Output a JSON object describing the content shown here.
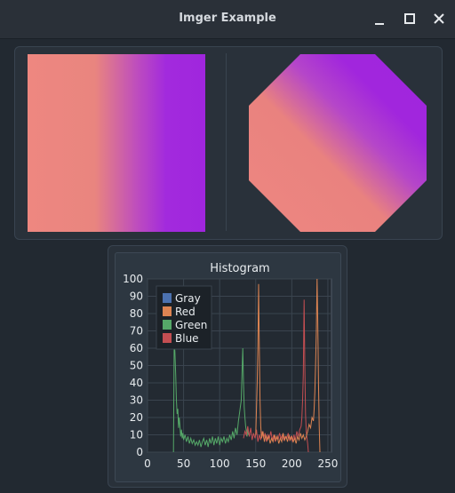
{
  "window": {
    "title": "Imger Example",
    "controls": [
      "minimize-icon",
      "maximize-icon",
      "close-icon"
    ]
  },
  "images": {
    "left_label": "gradient-square",
    "right_label": "gradient-octagon",
    "colors": {
      "pink": "#ee8780",
      "purple": "#a126dd"
    }
  },
  "chart_data": {
    "type": "line",
    "title": "Histogram",
    "xlim": [
      0,
      255
    ],
    "ylim": [
      0,
      100
    ],
    "xticks": [
      0,
      50,
      100,
      150,
      200,
      250
    ],
    "yticks": [
      0,
      10,
      20,
      30,
      40,
      50,
      60,
      70,
      80,
      90,
      100
    ],
    "legend": {
      "placement": "top-left",
      "entries": [
        {
          "name": "Gray",
          "color": "#4c72b0"
        },
        {
          "name": "Red",
          "color": "#dd8452"
        },
        {
          "name": "Green",
          "color": "#55a868"
        },
        {
          "name": "Blue",
          "color": "#c44e52"
        }
      ]
    },
    "series": [
      {
        "name": "Gray",
        "color": "#4c72b0",
        "points": []
      },
      {
        "name": "Green",
        "color": "#55a868",
        "points": [
          [
            36,
            0
          ],
          [
            37,
            64
          ],
          [
            38,
            58
          ],
          [
            39,
            45
          ],
          [
            40,
            30
          ],
          [
            41,
            22
          ],
          [
            42,
            25
          ],
          [
            43,
            14
          ],
          [
            44,
            20
          ],
          [
            45,
            15
          ],
          [
            46,
            9
          ],
          [
            47,
            13
          ],
          [
            48,
            8
          ],
          [
            49,
            11
          ],
          [
            50,
            7
          ],
          [
            52,
            10
          ],
          [
            54,
            6
          ],
          [
            56,
            9
          ],
          [
            58,
            5
          ],
          [
            60,
            8
          ],
          [
            62,
            5
          ],
          [
            64,
            7
          ],
          [
            66,
            4
          ],
          [
            68,
            6
          ],
          [
            70,
            4
          ],
          [
            72,
            7
          ],
          [
            74,
            3
          ],
          [
            76,
            6
          ],
          [
            78,
            8
          ],
          [
            80,
            4
          ],
          [
            82,
            7
          ],
          [
            84,
            3
          ],
          [
            86,
            8
          ],
          [
            88,
            5
          ],
          [
            90,
            9
          ],
          [
            92,
            4
          ],
          [
            94,
            8
          ],
          [
            96,
            5
          ],
          [
            98,
            9
          ],
          [
            100,
            4
          ],
          [
            102,
            8
          ],
          [
            104,
            6
          ],
          [
            106,
            9
          ],
          [
            108,
            5
          ],
          [
            110,
            8
          ],
          [
            112,
            6
          ],
          [
            114,
            10
          ],
          [
            116,
            7
          ],
          [
            118,
            12
          ],
          [
            120,
            8
          ],
          [
            122,
            14
          ],
          [
            124,
            10
          ],
          [
            126,
            18
          ],
          [
            128,
            24
          ],
          [
            130,
            30
          ],
          [
            131,
            45
          ],
          [
            132,
            60
          ],
          [
            133,
            40
          ],
          [
            134,
            26
          ],
          [
            135,
            20
          ],
          [
            136,
            15
          ],
          [
            137,
            12
          ],
          [
            138,
            9
          ],
          [
            139,
            14
          ],
          [
            140,
            10
          ]
        ]
      },
      {
        "name": "Blue",
        "color": "#c44e52",
        "points": [
          [
            133,
            8
          ],
          [
            135,
            12
          ],
          [
            137,
            10
          ],
          [
            139,
            15
          ],
          [
            141,
            9
          ],
          [
            143,
            14
          ],
          [
            145,
            7
          ],
          [
            147,
            11
          ],
          [
            149,
            8
          ],
          [
            151,
            13
          ],
          [
            153,
            6
          ],
          [
            155,
            10
          ],
          [
            157,
            7
          ],
          [
            159,
            12
          ],
          [
            161,
            8
          ],
          [
            163,
            11
          ],
          [
            165,
            6
          ],
          [
            167,
            10
          ],
          [
            169,
            8
          ],
          [
            171,
            12
          ],
          [
            173,
            7
          ],
          [
            175,
            10
          ],
          [
            177,
            6
          ],
          [
            179,
            9
          ],
          [
            181,
            7
          ],
          [
            183,
            11
          ],
          [
            185,
            8
          ],
          [
            187,
            10
          ],
          [
            189,
            7
          ],
          [
            191,
            9
          ],
          [
            193,
            8
          ],
          [
            195,
            11
          ],
          [
            197,
            7
          ],
          [
            199,
            9
          ],
          [
            201,
            6
          ],
          [
            203,
            10
          ],
          [
            205,
            7
          ],
          [
            207,
            12
          ],
          [
            209,
            9
          ],
          [
            211,
            13
          ],
          [
            213,
            15
          ],
          [
            214,
            20
          ],
          [
            215,
            30
          ],
          [
            216,
            45
          ],
          [
            217,
            88
          ],
          [
            218,
            50
          ],
          [
            219,
            22
          ],
          [
            220,
            12
          ],
          [
            221,
            8
          ],
          [
            222,
            5
          ],
          [
            223,
            0
          ]
        ]
      },
      {
        "name": "Red",
        "color": "#dd8452",
        "points": [
          [
            150,
            10
          ],
          [
            151,
            25
          ],
          [
            152,
            40
          ],
          [
            153,
            60
          ],
          [
            154,
            97
          ],
          [
            155,
            60
          ],
          [
            156,
            30
          ],
          [
            157,
            15
          ],
          [
            158,
            8
          ],
          [
            160,
            12
          ],
          [
            162,
            6
          ],
          [
            164,
            10
          ],
          [
            166,
            7
          ],
          [
            168,
            9
          ],
          [
            170,
            5
          ],
          [
            172,
            8
          ],
          [
            174,
            6
          ],
          [
            176,
            10
          ],
          [
            178,
            7
          ],
          [
            180,
            9
          ],
          [
            182,
            5
          ],
          [
            184,
            8
          ],
          [
            186,
            6
          ],
          [
            188,
            11
          ],
          [
            190,
            7
          ],
          [
            192,
            9
          ],
          [
            194,
            6
          ],
          [
            196,
            10
          ],
          [
            198,
            7
          ],
          [
            200,
            9
          ],
          [
            202,
            6
          ],
          [
            204,
            8
          ],
          [
            206,
            5
          ],
          [
            208,
            9
          ],
          [
            210,
            7
          ],
          [
            212,
            11
          ],
          [
            214,
            8
          ],
          [
            216,
            10
          ],
          [
            218,
            7
          ],
          [
            220,
            9
          ],
          [
            222,
            12
          ],
          [
            224,
            16
          ],
          [
            226,
            14
          ],
          [
            228,
            20
          ],
          [
            230,
            18
          ],
          [
            231,
            25
          ],
          [
            232,
            35
          ],
          [
            233,
            50
          ],
          [
            234,
            70
          ],
          [
            235,
            100
          ],
          [
            236,
            75
          ],
          [
            237,
            40
          ],
          [
            238,
            15
          ],
          [
            239,
            0
          ]
        ]
      }
    ]
  }
}
